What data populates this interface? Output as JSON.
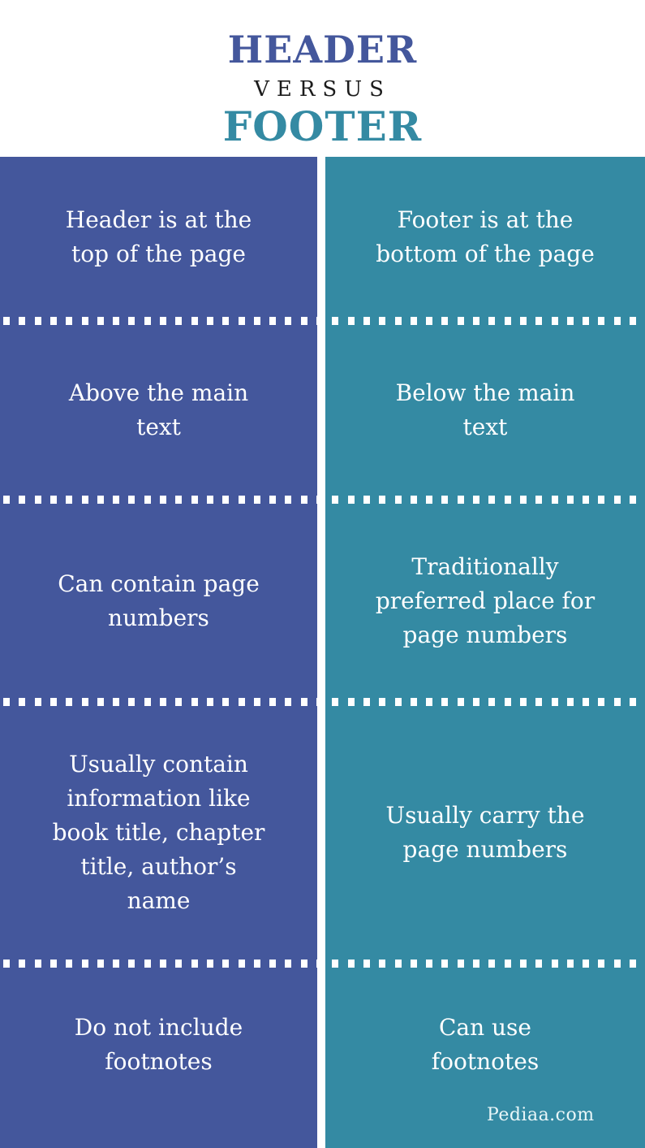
{
  "title": {
    "left_term": "HEADER",
    "connector": "VERSUS",
    "right_term": "FOOTER"
  },
  "colors": {
    "header_column": "#44579c",
    "footer_column": "#348aa3",
    "text": "#ffffff"
  },
  "rows": [
    {
      "header": "Header is at the\ntop of the page",
      "footer": "Footer is at the\nbottom of the page"
    },
    {
      "header": "Above the main\ntext",
      "footer": "Below the main\ntext"
    },
    {
      "header": "Can contain page\nnumbers",
      "footer": "Traditionally\npreferred place for\npage numbers"
    },
    {
      "header": "Usually contain\ninformation like\nbook title, chapter\ntitle, author’s\nname",
      "footer": "Usually carry the\npage numbers"
    },
    {
      "header": "Do not include\nfootnotes",
      "footer": "Can use\nfootnotes"
    }
  ],
  "brand": "Pediaa.com"
}
